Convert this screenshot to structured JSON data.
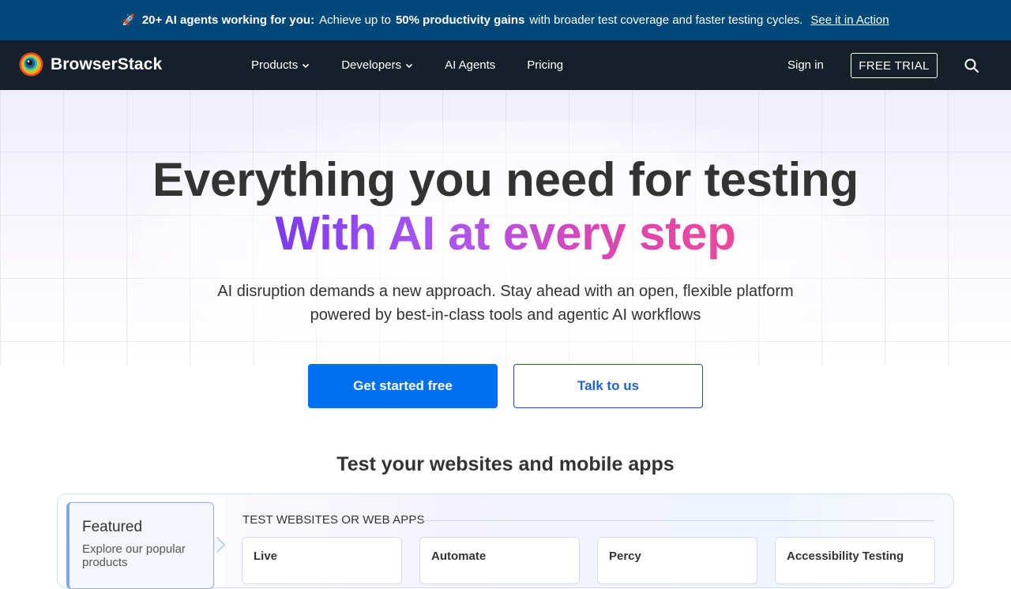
{
  "banner": {
    "rocket": "🚀",
    "bold_lead": "20+ AI agents working for you:",
    "text_a": "Achieve up to",
    "bold_mid": "50% productivity gains",
    "text_b": "with broader test coverage and faster testing cycles.",
    "link": "See it in Action"
  },
  "nav": {
    "brand": "BrowserStack",
    "items": [
      {
        "label": "Products",
        "dropdown": true
      },
      {
        "label": "Developers",
        "dropdown": true
      },
      {
        "label": "AI Agents",
        "dropdown": false
      },
      {
        "label": "Pricing",
        "dropdown": false
      }
    ],
    "signin": "Sign in",
    "trial": "FREE TRIAL",
    "search_icon": "search-icon"
  },
  "hero": {
    "line1": "Everything you need for testing",
    "line2": "With AI at every step",
    "sub_line1": "AI disruption demands a new approach. Stay ahead with an open, flexible platform",
    "sub_line2": "powered by best-in-class tools and agentic AI workflows",
    "cta_primary": "Get started free",
    "cta_secondary": "Talk to us"
  },
  "products": {
    "title": "Test your websites and mobile apps",
    "featured_title": "Featured",
    "featured_desc": "Explore our popular products",
    "category": "TEST WEBSITES OR WEB APPS",
    "cards": [
      "Live",
      "Automate",
      "Percy",
      "Accessibility Testing"
    ]
  },
  "colors": {
    "banner_bg": "#004879",
    "nav_bg": "#15202b",
    "primary": "#0070f0",
    "gradient_start": "#7c3aed",
    "gradient_end": "#ec4899"
  }
}
